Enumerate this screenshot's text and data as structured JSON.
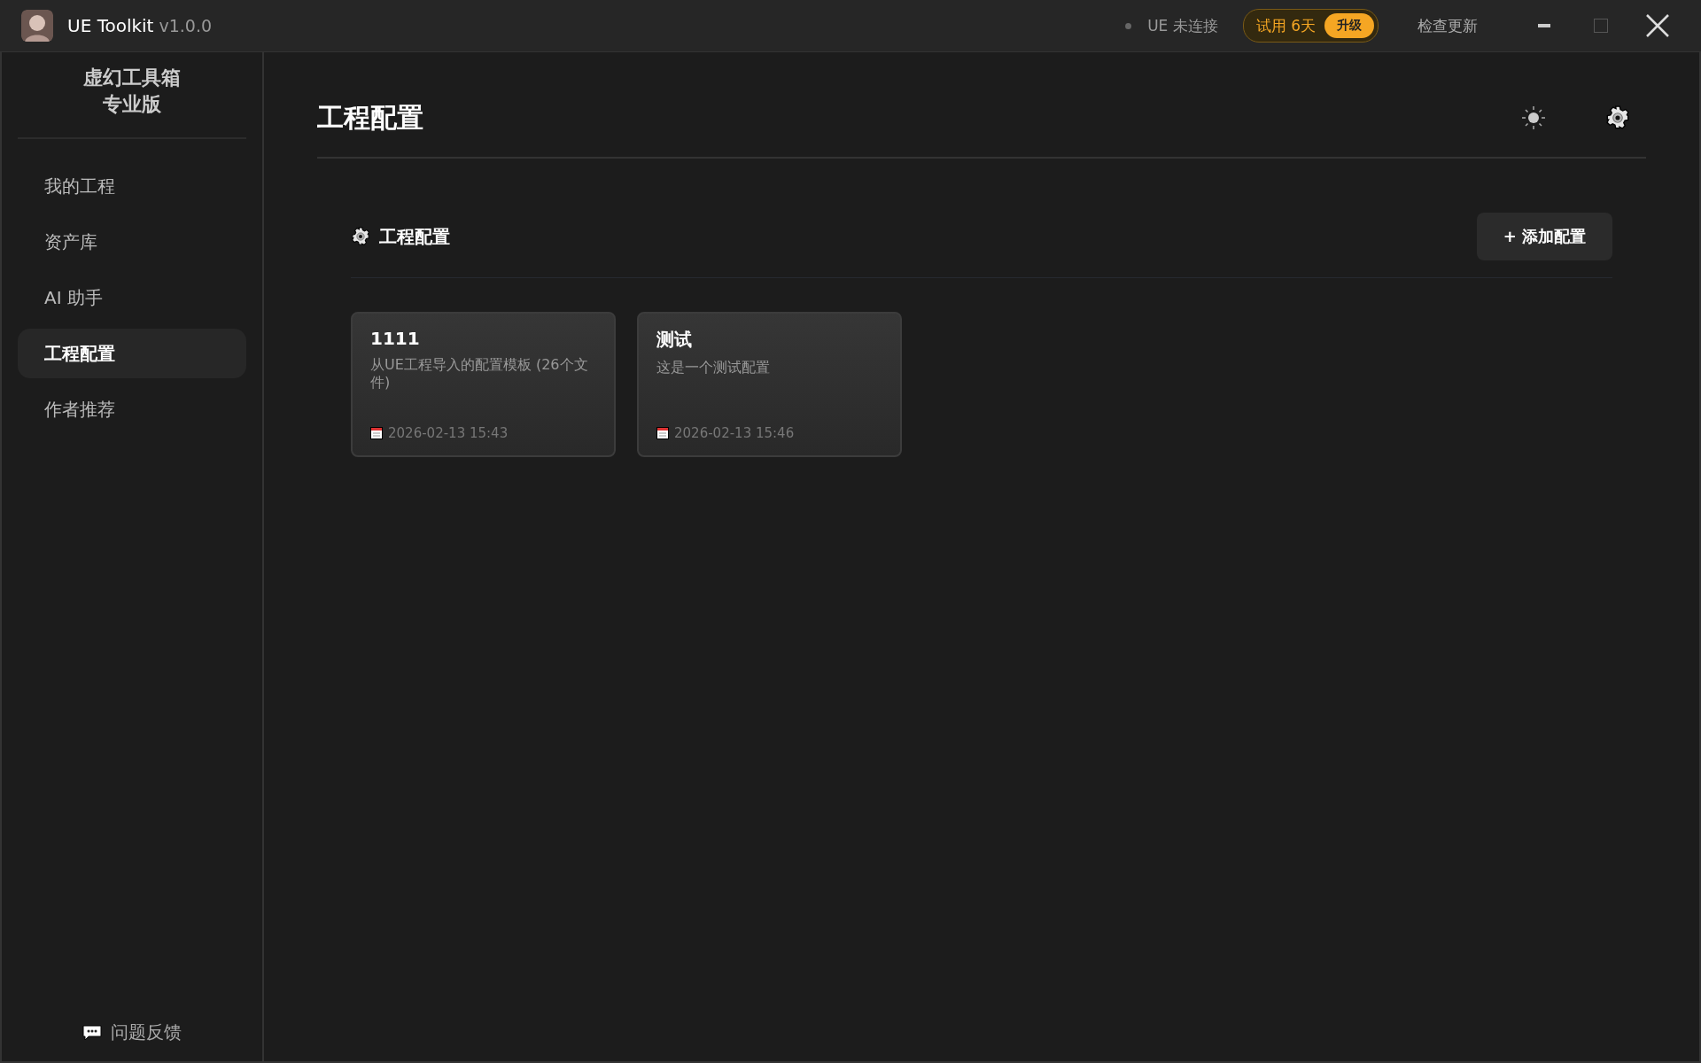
{
  "window": {
    "title": "UE Toolkit",
    "version": "v1.0.0"
  },
  "titlebar": {
    "status": {
      "label": "UE 未连接",
      "connected": false
    },
    "trial": "试用 6天",
    "upgrade": "升级",
    "check_update": "检查更新"
  },
  "sidebar": {
    "brand": [
      "虚幻工具箱",
      "专业版"
    ],
    "items": [
      {
        "label": "我的工程",
        "selected": false
      },
      {
        "label": "资产库",
        "selected": false
      },
      {
        "label": "AI 助手",
        "selected": false
      },
      {
        "label": "工程配置",
        "selected": true
      },
      {
        "label": "作者推荐",
        "selected": false
      }
    ],
    "feedback": "问题反馈"
  },
  "page": {
    "title": "工程配置"
  },
  "section": {
    "title": "工程配置",
    "add_button": "+ 添加配置"
  },
  "cards": [
    {
      "title": "1111",
      "description": "从UE工程导入的配置模板 (26个文件)",
      "date": "2026-02-13 15:43"
    },
    {
      "title": "测试",
      "description": "这是一个测试配置",
      "date": "2026-02-13 15:46"
    }
  ]
}
